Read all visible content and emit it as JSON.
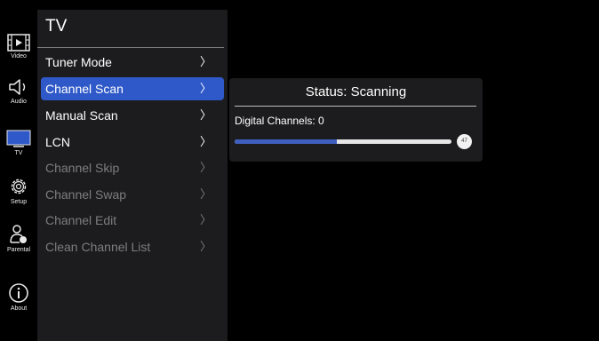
{
  "rail": [
    {
      "id": "video",
      "label": "Video",
      "icon": "film-icon"
    },
    {
      "id": "audio",
      "label": "Audio",
      "icon": "speaker-icon"
    },
    {
      "id": "tv",
      "label": "TV",
      "icon": "monitor-icon"
    },
    {
      "id": "setup",
      "label": "Setup",
      "icon": "gear-icon"
    },
    {
      "id": "parental",
      "label": "Parental",
      "icon": "user-lock-icon"
    },
    {
      "id": "about",
      "label": "About",
      "icon": "info-icon"
    }
  ],
  "menu": {
    "title": "TV",
    "items": [
      {
        "label": "Tuner Mode",
        "state": "enabled"
      },
      {
        "label": "Channel Scan",
        "state": "selected"
      },
      {
        "label": "Manual Scan",
        "state": "enabled"
      },
      {
        "label": "LCN",
        "state": "enabled"
      },
      {
        "label": "Channel Skip",
        "state": "disabled"
      },
      {
        "label": "Channel Swap",
        "state": "disabled"
      },
      {
        "label": "Channel Edit",
        "state": "disabled"
      },
      {
        "label": "Clean Channel List",
        "state": "disabled"
      }
    ],
    "chevron": "〉"
  },
  "scan": {
    "status": "Status: Scanning",
    "digital_channels": "Digital Channels: 0",
    "progress": 47
  },
  "colors": {
    "accent": "#2f59c8",
    "panel": "#1c1c1e",
    "progress": "#3e5fbf"
  }
}
